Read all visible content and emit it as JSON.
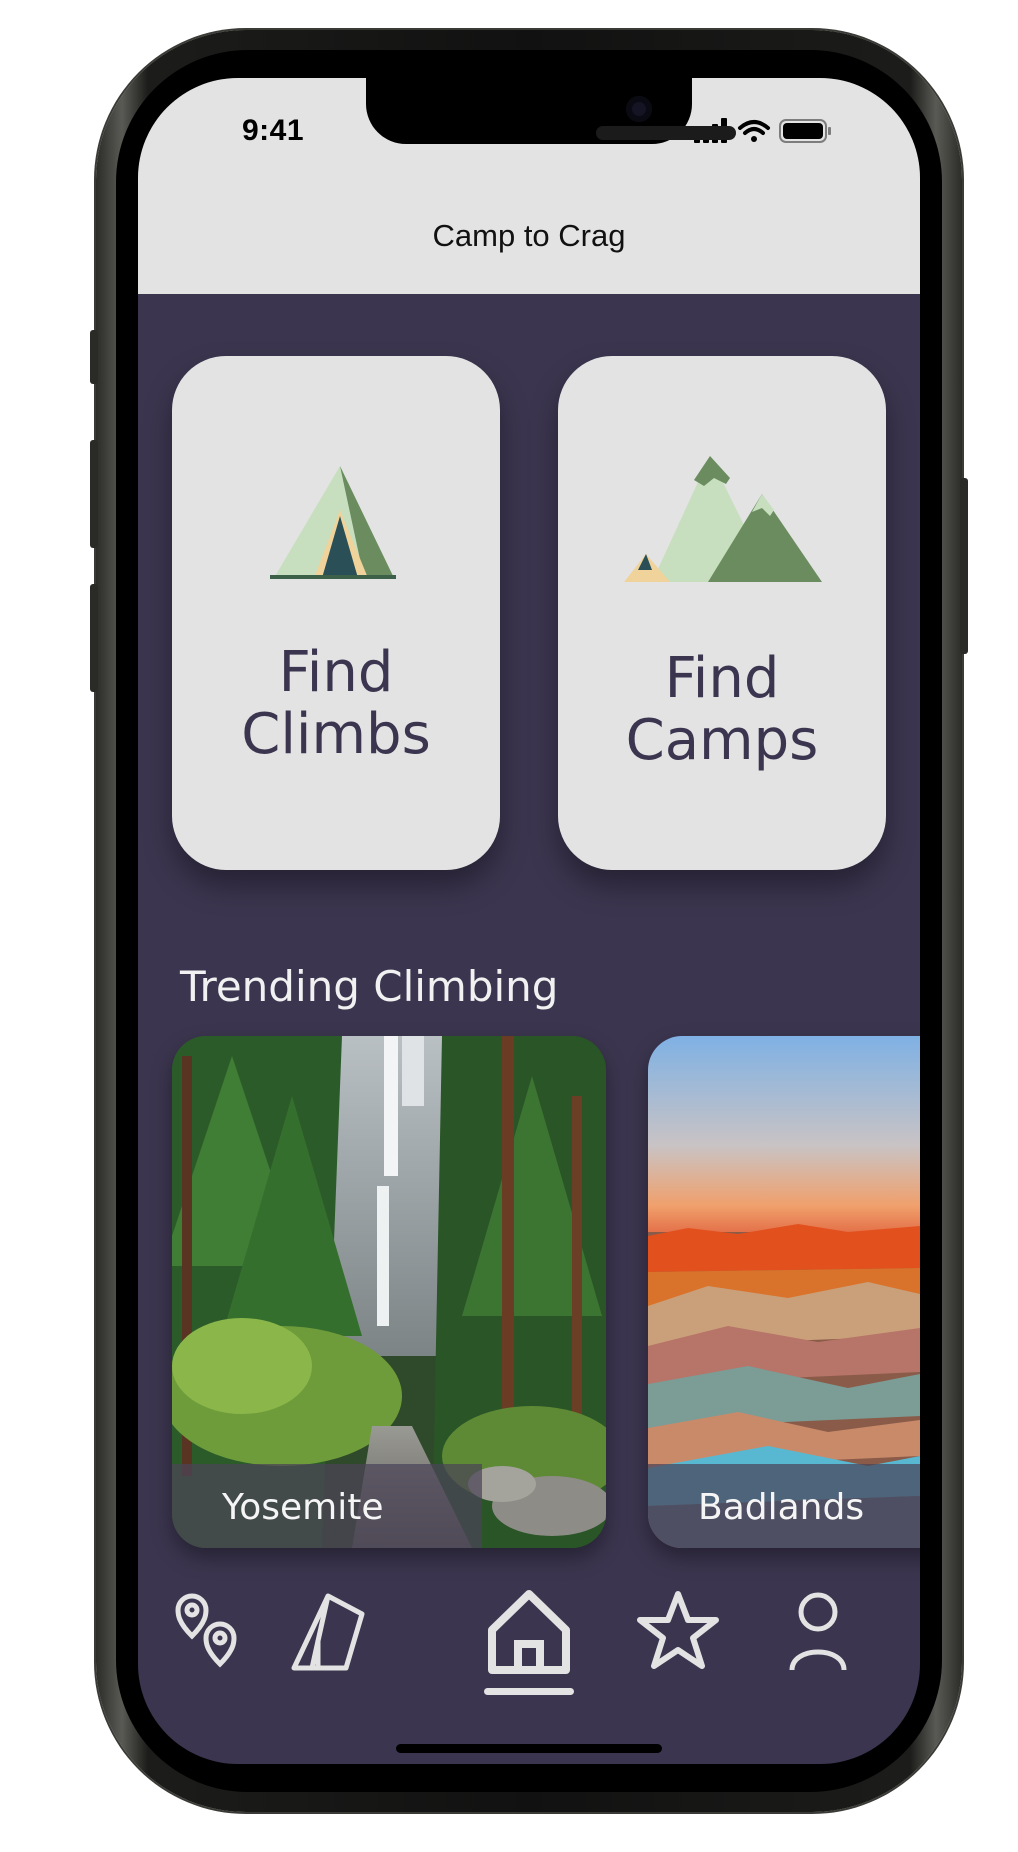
{
  "status_bar": {
    "time": "9:41",
    "icons": [
      "signal-icon",
      "wifi-icon",
      "battery-icon"
    ]
  },
  "app": {
    "title": "Camp to Crag"
  },
  "cards": {
    "climbs": {
      "line1": "Find",
      "line2": "Climbs",
      "icon": "tent-icon"
    },
    "camps": {
      "line1": "Find",
      "line2": "Camps",
      "icon": "mountains-icon"
    }
  },
  "trending": {
    "title": "Trending Climbing",
    "items": [
      {
        "label": "Yosemite",
        "image": "waterfall-forest-photo"
      },
      {
        "label": "Badlands",
        "image": "badlands-rock-photo"
      }
    ]
  },
  "nav": {
    "items": [
      {
        "icon": "map-pins-icon",
        "active": false
      },
      {
        "icon": "tent-outline-icon",
        "active": false
      },
      {
        "icon": "home-icon",
        "active": true
      },
      {
        "icon": "star-icon",
        "active": false
      },
      {
        "icon": "profile-icon",
        "active": false
      }
    ]
  },
  "colors": {
    "background": "#3b354f",
    "card": "#e3e3e3",
    "header": "#e3e3e3",
    "text_dark": "#3b354f",
    "green_light": "#c7dfbe",
    "green_dark": "#6b8c5f",
    "teal": "#2b4f57",
    "sand": "#efd39b"
  }
}
